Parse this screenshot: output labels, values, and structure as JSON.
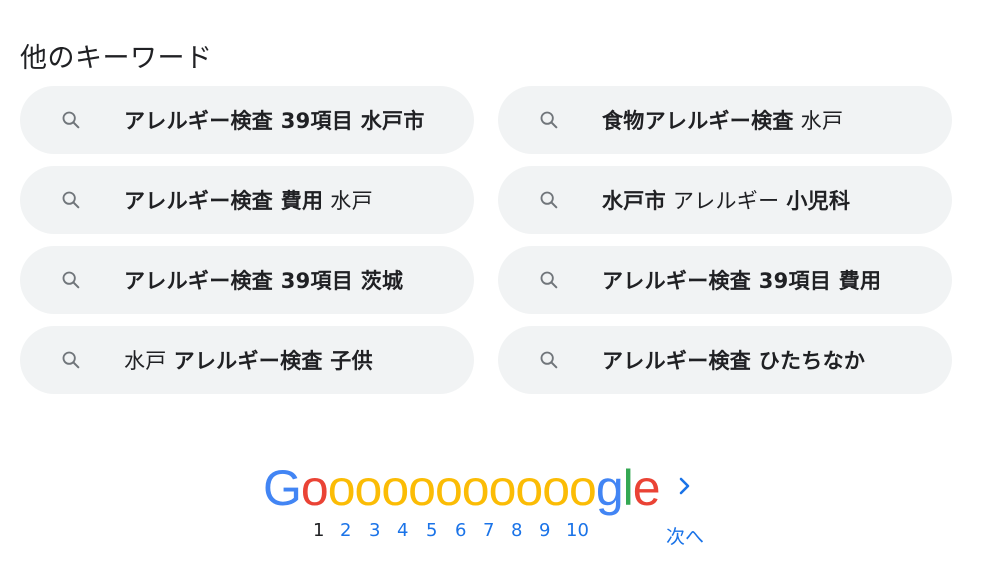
{
  "section_title": "他のキーワード",
  "keywords": [
    {
      "parts": [
        {
          "text": "アレルギー検査 39項目 水戸市",
          "bold": true
        }
      ]
    },
    {
      "parts": [
        {
          "text": "食物アレルギー検査",
          "bold": true
        },
        {
          "text": " 水戸",
          "bold": false
        }
      ]
    },
    {
      "parts": [
        {
          "text": "アレルギー検査 費用",
          "bold": true
        },
        {
          "text": " 水戸",
          "bold": false
        }
      ]
    },
    {
      "parts": [
        {
          "text": "水戸市",
          "bold": true
        },
        {
          "text": " アレルギー ",
          "bold": false
        },
        {
          "text": "小児科",
          "bold": true
        }
      ]
    },
    {
      "parts": [
        {
          "text": "アレルギー検査 39項目 茨城",
          "bold": true
        }
      ]
    },
    {
      "parts": [
        {
          "text": "アレルギー検査 39項目 費用",
          "bold": true
        }
      ]
    },
    {
      "parts": [
        {
          "text": "水戸 ",
          "bold": false
        },
        {
          "text": "アレルギー検査 子供",
          "bold": true
        }
      ]
    },
    {
      "parts": [
        {
          "text": "アレルギー検査 ひたちなか",
          "bold": true
        }
      ]
    }
  ],
  "search_icon": "search-icon",
  "pagination": {
    "logo_letters": [
      "G",
      "o",
      "o",
      "o",
      "o",
      "o",
      "o",
      "o",
      "o",
      "o",
      "o",
      "o",
      "g",
      "l",
      "e"
    ],
    "logo_colors": [
      "#4285f4",
      "#ea4335",
      "#fbbc05",
      "#fbbc05",
      "#fbbc05",
      "#fbbc05",
      "#fbbc05",
      "#fbbc05",
      "#fbbc05",
      "#fbbc05",
      "#fbbc05",
      "#fbbc05",
      "#4285f4",
      "#34a853",
      "#ea4335"
    ],
    "pages": [
      "1",
      "2",
      "3",
      "4",
      "5",
      "6",
      "7",
      "8",
      "9",
      "10"
    ],
    "current_page": "1",
    "next_label": "次へ",
    "next_icon": "chevron-right-icon"
  },
  "colors": {
    "chip_bg": "#f1f3f4",
    "link_blue": "#1a73e8",
    "text": "#202124",
    "icon_gray": "#70757a"
  }
}
